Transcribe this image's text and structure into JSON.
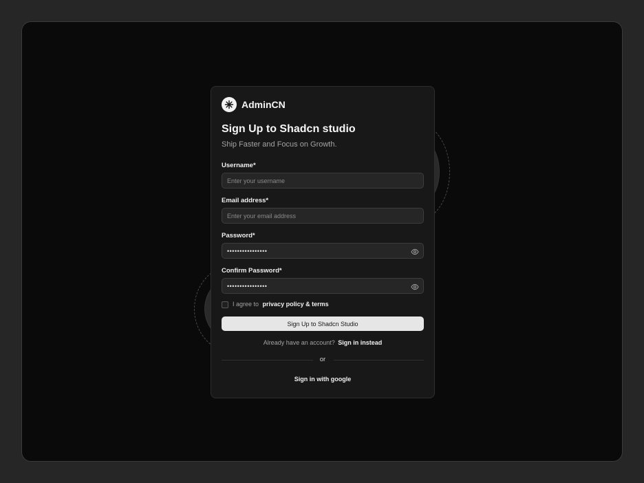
{
  "brand": {
    "name": "AdminCN",
    "logo_icon": "asterisk-icon"
  },
  "form": {
    "title": "Sign Up to Shadcn studio",
    "subtitle": "Ship Faster and Focus on Growth.",
    "username": {
      "label": "Username*",
      "placeholder": "Enter your username",
      "value": ""
    },
    "email": {
      "label": "Email address*",
      "placeholder": "Enter your email address",
      "value": ""
    },
    "password": {
      "label": "Password*",
      "value": "••••••••••••••••",
      "toggle_icon": "eye-icon"
    },
    "confirm_password": {
      "label": "Confirm Password*",
      "value": "••••••••••••••••",
      "toggle_icon": "eye-icon"
    },
    "agree": {
      "checked": false,
      "text": "I agree to",
      "link": "privacy policy & terms"
    },
    "submit_label": "Sign Up to Shadcn Studio",
    "have_account": {
      "text": "Already have an account?",
      "link": "Sign in instead"
    },
    "divider_text": "or",
    "google_label": "Sign in with google"
  },
  "colors": {
    "page_bg": "#262626",
    "frame_bg": "#0a0a0a",
    "card_bg": "#181818",
    "input_bg": "#262626",
    "button_bg": "#e6e6e6",
    "text_primary": "#f5f5f5",
    "text_muted": "#a3a3a3"
  }
}
